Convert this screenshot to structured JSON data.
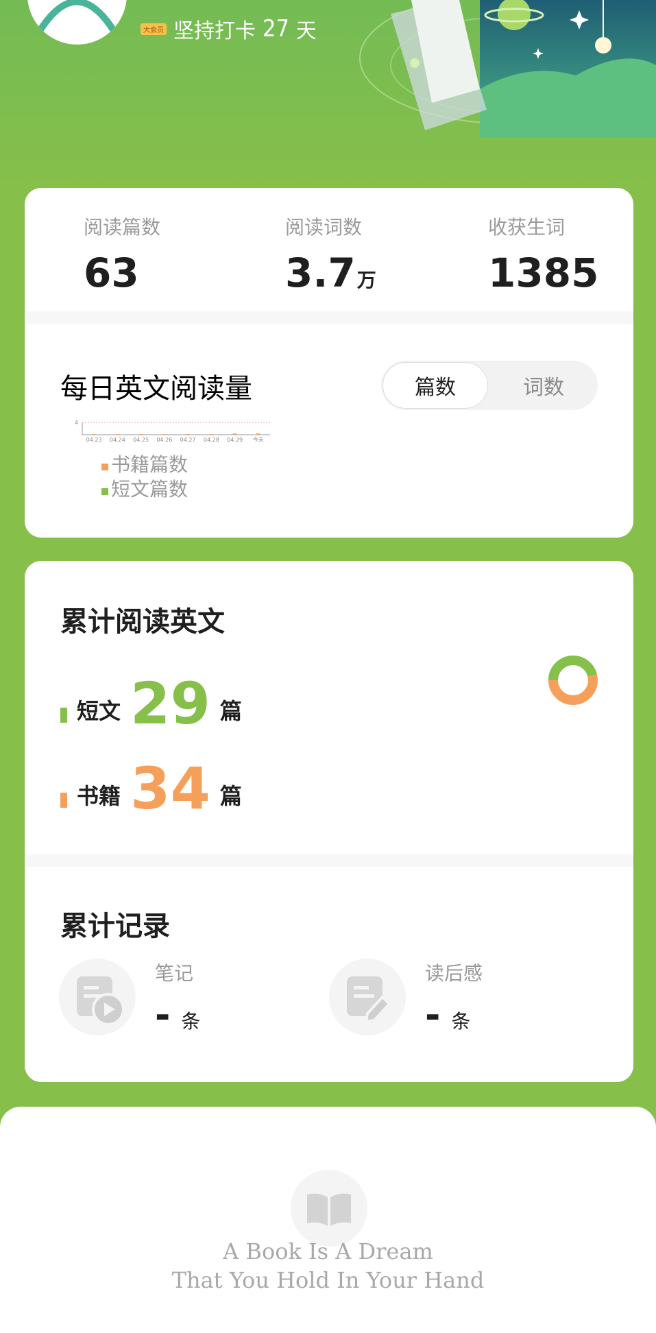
{
  "header": {
    "badge": "大会员",
    "streak_prefix": "坚持打卡",
    "streak_days": "27",
    "streak_suffix": "天"
  },
  "stats": [
    {
      "label": "阅读篇数",
      "value": "63",
      "unit": ""
    },
    {
      "label": "阅读词数",
      "value": "3.7",
      "unit": "万"
    },
    {
      "label": "收获生词",
      "value": "1385",
      "unit": ""
    }
  ],
  "daily": {
    "title": "每日英文阅读量",
    "tabs": [
      {
        "label": "篇数",
        "active": true
      },
      {
        "label": "词数",
        "active": false
      }
    ],
    "legend": [
      {
        "label": "书籍篇数",
        "color": "#f5a05a"
      },
      {
        "label": "短文篇数",
        "color": "#86bf4a"
      }
    ]
  },
  "chart_data": {
    "type": "bar",
    "categories": [
      "04.23",
      "04.24",
      "04.25",
      "04.26",
      "04.27",
      "04.28",
      "04.29",
      "今天"
    ],
    "ylim": [
      0,
      4
    ],
    "yticks": [
      "4"
    ],
    "series": [
      {
        "name": "书籍篇数",
        "color": "#f5a05a",
        "values": [
          0.2,
          0.2,
          0.2,
          0.2,
          0.2,
          0.2,
          0.4,
          0.4
        ]
      },
      {
        "name": "短文篇数",
        "color": "#86bf4a",
        "values": [
          0,
          0,
          0,
          0,
          0,
          0,
          0,
          0
        ]
      }
    ]
  },
  "cumulative": {
    "title": "累计阅读英文",
    "rows": [
      {
        "label": "短文",
        "value": "29",
        "unit": "篇",
        "color": "#86bf4a"
      },
      {
        "label": "书籍",
        "value": "34",
        "unit": "篇",
        "color": "#f5a05a"
      }
    ],
    "donut": [
      {
        "value": 29,
        "color": "#86bf4a"
      },
      {
        "value": 34,
        "color": "#f5a05a"
      }
    ]
  },
  "records": {
    "title": "累计记录",
    "items": [
      {
        "label": "笔记",
        "value": "-",
        "unit": "条",
        "icon": "note-play-icon"
      },
      {
        "label": "读后感",
        "value": "-",
        "unit": "条",
        "icon": "note-edit-icon"
      }
    ]
  },
  "footer": {
    "quote_line1": "A Book Is A Dream",
    "quote_line2": "That You Hold In Your Hand",
    "icon": "open-book-icon"
  }
}
